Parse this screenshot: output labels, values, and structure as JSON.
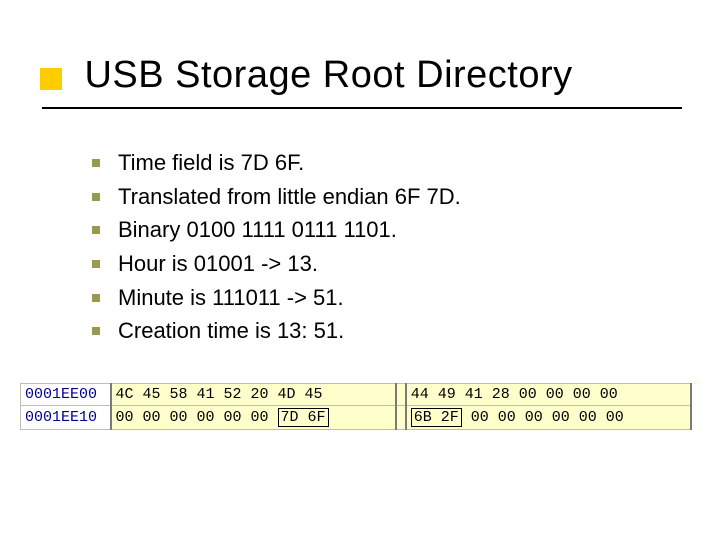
{
  "title": "USB Storage Root Directory",
  "bullets": [
    "Time field is 7D 6F.",
    "Translated from little endian 6F 7D.",
    "Binary 0100 1111 0111 1101.",
    "Hour is 01001 -> 13.",
    "Minute is 111011 -> 51.",
    "Creation time is 13: 51."
  ],
  "hex": {
    "rows": [
      {
        "addr": "0001EE00",
        "g1": "4C 45 58 41 52 20 4D 45",
        "g2_plain": "44 49 41 28 00 00 00 00",
        "g2_box_a": "",
        "g2_mid": "",
        "g2_box_b": "",
        "g2_tail": ""
      },
      {
        "addr": "0001EE10",
        "g1": "00 00 00 00 00 00 ",
        "g2_plain": "",
        "g2_box_a": "7D 6F",
        "g2_mid": "",
        "g2_box_b": "6B 2F",
        "g2_tail": " 00 00 00 00 00 00"
      }
    ]
  }
}
